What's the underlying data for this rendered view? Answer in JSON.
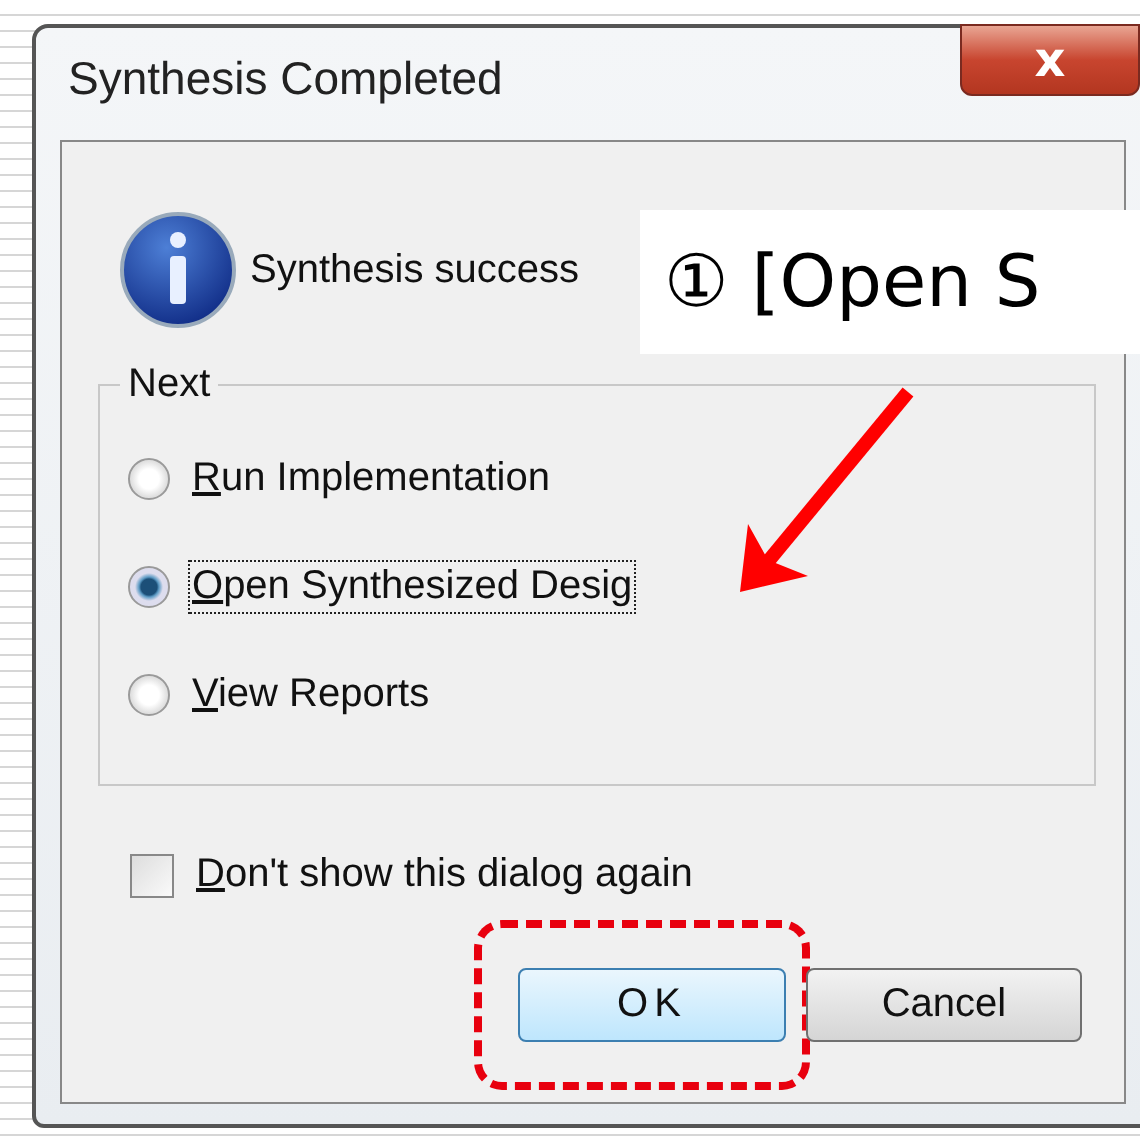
{
  "window": {
    "title": "Synthesis Completed",
    "close_label": "x"
  },
  "message": {
    "text": "Synthesis success"
  },
  "next_group": {
    "title": "Next",
    "options": [
      {
        "label": "Run Implementation",
        "selected": false,
        "focused": false,
        "mnemonic": true
      },
      {
        "label": "Open Synthesized Desig",
        "selected": true,
        "focused": true,
        "mnemonic": true
      },
      {
        "label": "View Reports",
        "selected": false,
        "focused": false,
        "mnemonic": true
      }
    ]
  },
  "dont_show": {
    "label": "Don't show this dialog again",
    "checked": false,
    "mnemonic": true
  },
  "buttons": [
    {
      "label": "OK",
      "default": true,
      "highlighted": true
    },
    {
      "label": "Cancel",
      "default": false,
      "highlighted": false
    }
  ],
  "callout": {
    "text": "① [Open S"
  }
}
